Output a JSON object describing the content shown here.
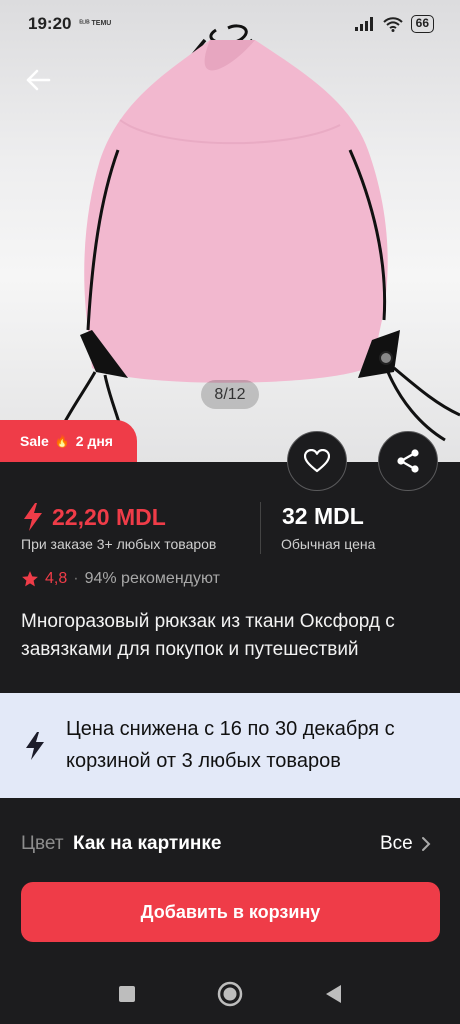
{
  "status_bar": {
    "time": "19:20",
    "mini_icons_text": "ᴱᴸᴵᴮ TEMU",
    "battery": "66"
  },
  "gallery": {
    "counter": "8/12"
  },
  "sale_tag": {
    "label": "Sale",
    "fire_icon": "🔥",
    "days": "2 дня"
  },
  "price": {
    "sale_value": "22,20 MDL",
    "sale_note": "При заказе 3+ любых товаров",
    "regular_value": "32 MDL",
    "regular_note": "Обычная цена"
  },
  "rating": {
    "score": "4,8",
    "separator": "·",
    "recommend": "94% рекомендуют"
  },
  "product_title": "Многоразовый рюкзак из ткани Оксфорд с завязками для покупок и путешествий",
  "promo": {
    "text": "Цена снижена с 16 по 30 декабря с корзиной от 3 любых товаров"
  },
  "color_option": {
    "label": "Цвет",
    "value": "Как на картинке",
    "all": "Все"
  },
  "add_to_cart": "Добавить в корзину",
  "colors": {
    "accent": "#ef3c48",
    "background": "#1c1c1e",
    "promo_bg": "#e3e9f8",
    "bag_pink": "#f2b8cf"
  },
  "icons": [
    "back-arrow-icon",
    "heart-icon",
    "share-icon",
    "lightning-icon",
    "star-icon",
    "chevron-right-icon",
    "nav-square-icon",
    "nav-circle-icon",
    "nav-back-triangle-icon",
    "wifi-icon",
    "signal-icon"
  ]
}
